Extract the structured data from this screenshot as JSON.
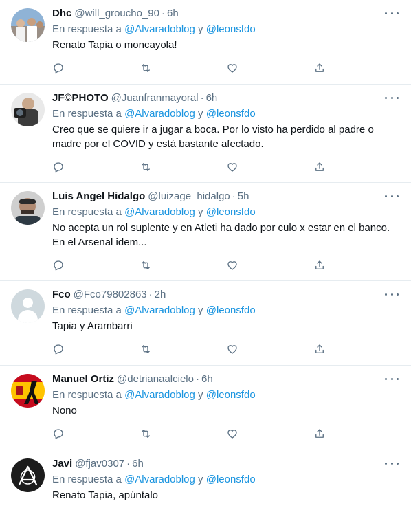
{
  "reply_prefix": "En respuesta a",
  "reply_conj": "y",
  "tweets": [
    {
      "name": "Dhc",
      "handle": "@will_groucho_90",
      "dot": "·",
      "time": "6h",
      "mention1": "@Alvaradoblog",
      "mention2": "@leonsfdo",
      "text": "Renato Tapia o moncayola!"
    },
    {
      "name": "JF©PHOTO",
      "handle": "@Juanfranmayoral",
      "dot": "·",
      "time": "6h",
      "mention1": "@Alvaradoblog",
      "mention2": "@leonsfdo",
      "text": "Creo que se quiere ir a jugar a boca. Por lo visto ha perdido al padre o madre por el COVID y está bastante afectado."
    },
    {
      "name": "Luis Angel Hidalgo",
      "handle": "@luizage_hidalgo",
      "dot": "·",
      "time": "5h",
      "mention1": "@Alvaradoblog",
      "mention2": "@leonsfdo",
      "text": "No acepta un rol suplente y en Atleti ha dado por culo x estar en el banco. En el Arsenal idem..."
    },
    {
      "name": "Fco",
      "handle": "@Fco79802863",
      "dot": "·",
      "time": "2h",
      "mention1": "@Alvaradoblog",
      "mention2": "@leonsfdo",
      "text": "Tapia y Arambarri"
    },
    {
      "name": "Manuel Ortiz",
      "handle": "@detrianaalcielo",
      "dot": "·",
      "time": "6h",
      "mention1": "@Alvaradoblog",
      "mention2": "@leonsfdo",
      "text": "Nono"
    },
    {
      "name": "Javi",
      "handle": "@fjav0307",
      "dot": "·",
      "time": "6h",
      "mention1": "@Alvaradoblog",
      "mention2": "@leonsfdo",
      "text": "Renato Tapia, apúntalo"
    }
  ]
}
